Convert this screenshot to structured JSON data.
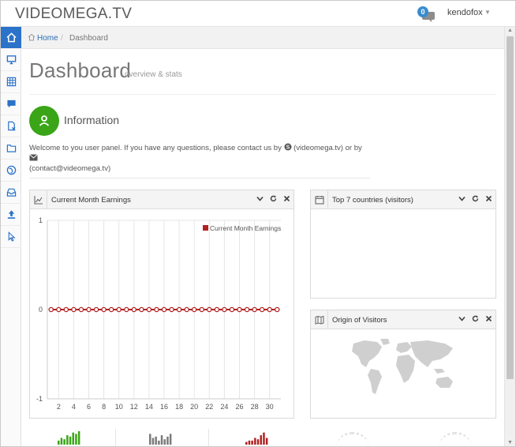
{
  "header": {
    "logo": "VIDEOMEGA.TV",
    "chat_badge": "0",
    "user_name": "kendofox"
  },
  "sidebar": {
    "items": [
      {
        "icon": "home-icon",
        "active": true
      },
      {
        "icon": "desktop-icon",
        "active": false
      },
      {
        "icon": "table-icon",
        "active": false
      },
      {
        "icon": "comment-icon",
        "active": false
      },
      {
        "icon": "file-remove-icon",
        "active": false
      },
      {
        "icon": "folder-icon",
        "active": false
      },
      {
        "icon": "globe-icon",
        "active": false
      },
      {
        "icon": "inbox-icon",
        "active": false
      },
      {
        "icon": "upload-icon",
        "active": false
      },
      {
        "icon": "pointer-icon",
        "active": false
      }
    ]
  },
  "breadcrumb": {
    "home": "Home",
    "separator": "/",
    "current": "Dashboard"
  },
  "page": {
    "title": "Dashboard",
    "subtitle": "overview & stats"
  },
  "info": {
    "title": "Information",
    "welcome_part1": "Welcome to you user panel. If you have any questions, please contact us by",
    "skype": "(videomega.tv) or by",
    "email": "(contact@videomega.tv)"
  },
  "widgets": {
    "earnings": {
      "title": "Current Month Earnings"
    },
    "top_countries": {
      "title": "Top 7 countries (visitors)"
    },
    "origin": {
      "title": "Origin of Visitors"
    }
  },
  "colors": {
    "accent": "#2b72c9",
    "info_green": "#3aa517",
    "series": "#b22222",
    "mini_green": "#3aa517",
    "mini_gray": "#7a7a7a",
    "mini_red": "#b22222"
  },
  "chart_data": {
    "type": "line",
    "series": [
      {
        "name": "Current Month Earnings",
        "x": [
          1,
          2,
          3,
          4,
          5,
          6,
          7,
          8,
          9,
          10,
          11,
          12,
          13,
          14,
          15,
          16,
          17,
          18,
          19,
          20,
          21,
          22,
          23,
          24,
          25,
          26,
          27,
          28,
          29,
          30,
          31
        ],
        "values": [
          0,
          0,
          0,
          0,
          0,
          0,
          0,
          0,
          0,
          0,
          0,
          0,
          0,
          0,
          0,
          0,
          0,
          0,
          0,
          0,
          0,
          0,
          0,
          0,
          0,
          0,
          0,
          0,
          0,
          0,
          0
        ]
      }
    ],
    "xticks": [
      2,
      4,
      6,
      8,
      10,
      12,
      14,
      16,
      18,
      20,
      22,
      24,
      26,
      28,
      30
    ],
    "yticks": [
      1,
      0,
      -1
    ],
    "ylim": [
      -1,
      1
    ],
    "xlim": [
      0.5,
      31.5
    ],
    "grid": true,
    "legend": "top-right"
  },
  "mini_stats": [
    {
      "color": "#3aa517",
      "bars": [
        3,
        5,
        4,
        7,
        6,
        9,
        8,
        10
      ]
    },
    {
      "color": "#7a7a7a",
      "bars": [
        8,
        5,
        6,
        3,
        7,
        4,
        6,
        8
      ]
    },
    {
      "color": "#b22222",
      "bars": [
        2,
        3,
        3,
        5,
        4,
        7,
        9,
        5
      ]
    }
  ]
}
